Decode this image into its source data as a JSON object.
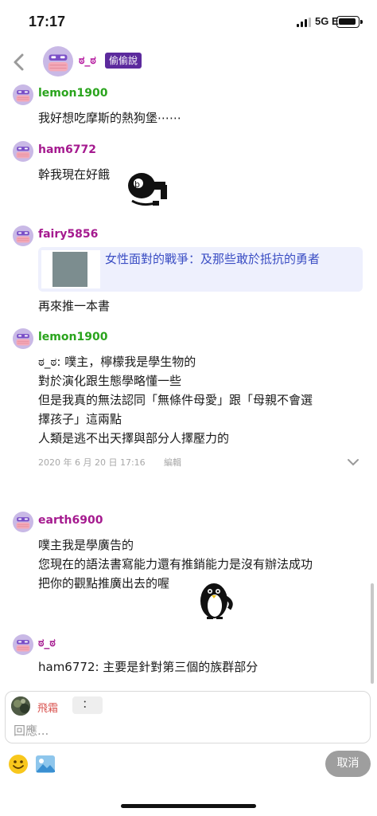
{
  "status_bar": {
    "time": "17:17",
    "network": "5G E"
  },
  "header": {
    "name": "ಠ_ಠ",
    "badge": "偷偷說"
  },
  "comments": [
    {
      "name": "lemon1900",
      "lines": [
        "我好想吃摩斯的熱狗堡⋯⋯"
      ]
    },
    {
      "name": "ham6772",
      "lines": [
        "幹我現在好餓"
      ]
    },
    {
      "name": "fairy5856",
      "book_title": "女性面對的戰爭：及那些敢於抵抗的勇者",
      "lines": [
        "再來推一本書"
      ]
    },
    {
      "name": "lemon1900",
      "lines": [
        "ಠ_ಠ: 噗主，檸檬我是學生物的",
        "對於演化跟生態學略懂一些",
        "但是我真的無法認同「無條件母愛」跟「母親不會選",
        "擇孩子」這兩點",
        "人類是逃不出天擇與部分人擇壓力的"
      ],
      "timestamp": "2020 年 6 月 20 日 17:16",
      "edit_label": "編輯"
    },
    {
      "name": "earth6900",
      "lines": [
        "噗主我是學廣告的",
        "您現在的語法書寫能力還有推銷能力是沒有辦法成功",
        "把你的觀點推廣出去的喔"
      ]
    },
    {
      "name": "ಠ_ಠ",
      "lines": [
        "ham6772: 主要是針對第三個的族群部分"
      ]
    }
  ],
  "composer": {
    "reply_to_name": "飛霜",
    "reply_chip": "：",
    "placeholder": "回應..."
  },
  "actions": {
    "cancel_label": "取消"
  },
  "colors": {
    "badge": "#5c2a9d",
    "name_green": "#2aa41d",
    "name_purple": "#a51a8f",
    "book_link": "#3b4ec4",
    "cancel_bg": "#9e9e9e"
  },
  "icons": [
    "back-arrow-icon",
    "mask-avatar-icon",
    "chevron-down-icon",
    "emoji-icon",
    "image-icon"
  ]
}
